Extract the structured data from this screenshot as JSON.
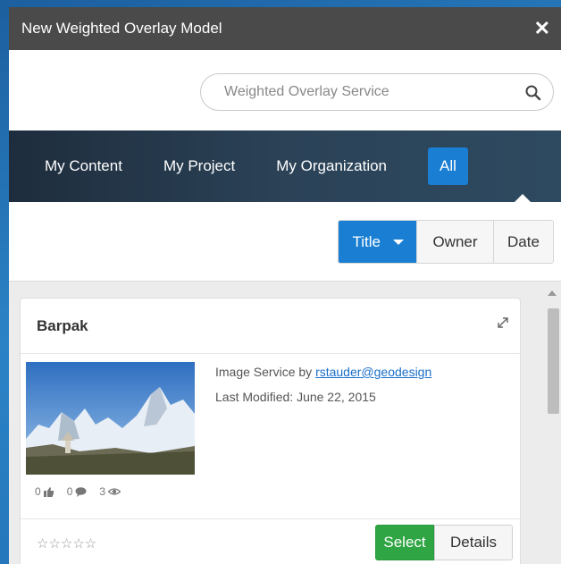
{
  "window": {
    "title": "New Weighted Overlay Model",
    "close_label": "✕"
  },
  "search": {
    "placeholder": "Weighted Overlay Service",
    "value": ""
  },
  "nav": {
    "tabs": [
      {
        "label": "My Content",
        "active": false
      },
      {
        "label": "My Project",
        "active": false
      },
      {
        "label": "My Organization",
        "active": false
      },
      {
        "label": "All",
        "active": true
      }
    ]
  },
  "sort": {
    "title_label": "Title",
    "owner_label": "Owner",
    "date_label": "Date",
    "active": "Title"
  },
  "items": [
    {
      "title": "Barpak",
      "type_text": "Image Service by",
      "owner": "rstauder@geodesign",
      "modified_label": "Last Modified:",
      "modified_date": "June 22, 2015",
      "likes": "0",
      "comments": "0",
      "views": "3",
      "rating_stars": "☆☆☆☆☆",
      "select_label": "Select",
      "details_label": "Details"
    }
  ],
  "colors": {
    "titlebar": "#4a4a4a",
    "accent": "#1a7fd3",
    "select_green": "#2fa543",
    "link": "#1a6fc8"
  }
}
